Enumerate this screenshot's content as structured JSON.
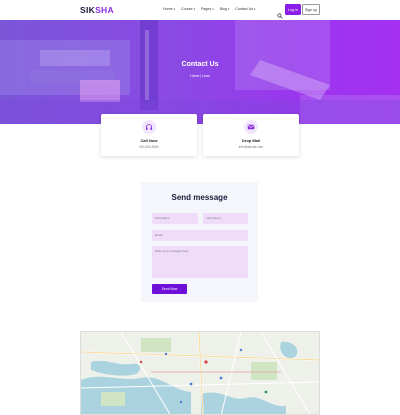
{
  "header": {
    "logo_main": "SIK",
    "logo_accent": "SHA",
    "nav": [
      {
        "label": "Home",
        "caret": "▾"
      },
      {
        "label": "Course",
        "caret": "▾"
      },
      {
        "label": "Pages",
        "caret": "▾"
      },
      {
        "label": "Blog",
        "caret": "▾"
      },
      {
        "label": "Contact Us",
        "caret": "▾"
      }
    ],
    "search_icon": "search-icon",
    "login_label": "Log in",
    "signup_label": "Sign up"
  },
  "hero": {
    "title": "Contact Us",
    "breadcrumb_home": "Home",
    "breadcrumb_sep": "|",
    "breadcrumb_current": "Lead"
  },
  "cards": [
    {
      "icon": "headphones-icon",
      "title": "Call Now",
      "value": "000-000-0000"
    },
    {
      "icon": "mail-icon",
      "title": "Drop Mail",
      "value": "info@siksha.com"
    }
  ],
  "form": {
    "title": "Send message",
    "first_name_placeholder": "First Name",
    "last_name_placeholder": "Last Name",
    "email_placeholder": "Email",
    "message_placeholder": "Write your message here",
    "submit_label": "Send Now"
  },
  "colors": {
    "accent": "#8a2be2",
    "button": "#6f10d8",
    "field_bg": "#efdcfb",
    "form_bg": "#f4f6fb"
  }
}
